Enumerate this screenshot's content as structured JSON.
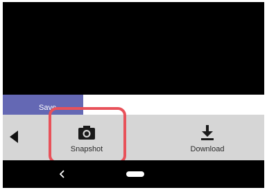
{
  "save_bar": {
    "label": "Save"
  },
  "toolbar": {
    "back_icon": "triangle-left-icon",
    "snapshot": {
      "label": "Snapshot",
      "icon": "camera-icon"
    },
    "download": {
      "label": "Download",
      "icon": "download-icon"
    }
  },
  "navigation": {
    "back_icon": "chevron-left-icon",
    "home_icon": "home-pill-icon"
  },
  "colors": {
    "save_fill": "#6468b4",
    "toolbar_bg": "#d6d6d6",
    "highlight": "#e8525a"
  }
}
